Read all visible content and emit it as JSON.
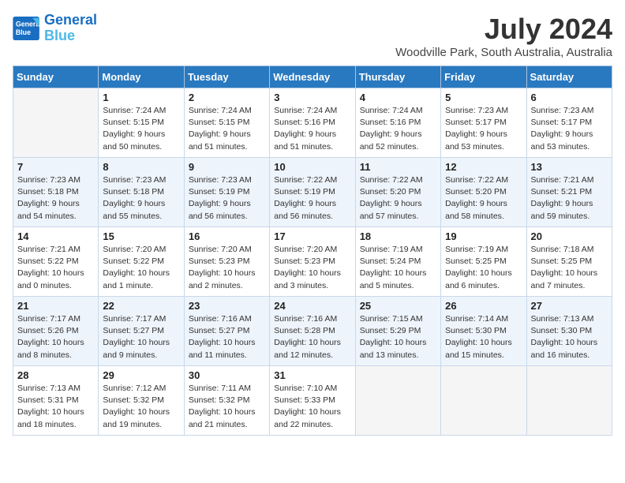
{
  "header": {
    "logo_line1": "General",
    "logo_line2": "Blue",
    "month": "July 2024",
    "location": "Woodville Park, South Australia, Australia"
  },
  "weekdays": [
    "Sunday",
    "Monday",
    "Tuesday",
    "Wednesday",
    "Thursday",
    "Friday",
    "Saturday"
  ],
  "weeks": [
    [
      {
        "day": "",
        "info": ""
      },
      {
        "day": "1",
        "info": "Sunrise: 7:24 AM\nSunset: 5:15 PM\nDaylight: 9 hours\nand 50 minutes."
      },
      {
        "day": "2",
        "info": "Sunrise: 7:24 AM\nSunset: 5:15 PM\nDaylight: 9 hours\nand 51 minutes."
      },
      {
        "day": "3",
        "info": "Sunrise: 7:24 AM\nSunset: 5:16 PM\nDaylight: 9 hours\nand 51 minutes."
      },
      {
        "day": "4",
        "info": "Sunrise: 7:24 AM\nSunset: 5:16 PM\nDaylight: 9 hours\nand 52 minutes."
      },
      {
        "day": "5",
        "info": "Sunrise: 7:23 AM\nSunset: 5:17 PM\nDaylight: 9 hours\nand 53 minutes."
      },
      {
        "day": "6",
        "info": "Sunrise: 7:23 AM\nSunset: 5:17 PM\nDaylight: 9 hours\nand 53 minutes."
      }
    ],
    [
      {
        "day": "7",
        "info": "Sunrise: 7:23 AM\nSunset: 5:18 PM\nDaylight: 9 hours\nand 54 minutes."
      },
      {
        "day": "8",
        "info": "Sunrise: 7:23 AM\nSunset: 5:18 PM\nDaylight: 9 hours\nand 55 minutes."
      },
      {
        "day": "9",
        "info": "Sunrise: 7:23 AM\nSunset: 5:19 PM\nDaylight: 9 hours\nand 56 minutes."
      },
      {
        "day": "10",
        "info": "Sunrise: 7:22 AM\nSunset: 5:19 PM\nDaylight: 9 hours\nand 56 minutes."
      },
      {
        "day": "11",
        "info": "Sunrise: 7:22 AM\nSunset: 5:20 PM\nDaylight: 9 hours\nand 57 minutes."
      },
      {
        "day": "12",
        "info": "Sunrise: 7:22 AM\nSunset: 5:20 PM\nDaylight: 9 hours\nand 58 minutes."
      },
      {
        "day": "13",
        "info": "Sunrise: 7:21 AM\nSunset: 5:21 PM\nDaylight: 9 hours\nand 59 minutes."
      }
    ],
    [
      {
        "day": "14",
        "info": "Sunrise: 7:21 AM\nSunset: 5:22 PM\nDaylight: 10 hours\nand 0 minutes."
      },
      {
        "day": "15",
        "info": "Sunrise: 7:20 AM\nSunset: 5:22 PM\nDaylight: 10 hours\nand 1 minute."
      },
      {
        "day": "16",
        "info": "Sunrise: 7:20 AM\nSunset: 5:23 PM\nDaylight: 10 hours\nand 2 minutes."
      },
      {
        "day": "17",
        "info": "Sunrise: 7:20 AM\nSunset: 5:23 PM\nDaylight: 10 hours\nand 3 minutes."
      },
      {
        "day": "18",
        "info": "Sunrise: 7:19 AM\nSunset: 5:24 PM\nDaylight: 10 hours\nand 5 minutes."
      },
      {
        "day": "19",
        "info": "Sunrise: 7:19 AM\nSunset: 5:25 PM\nDaylight: 10 hours\nand 6 minutes."
      },
      {
        "day": "20",
        "info": "Sunrise: 7:18 AM\nSunset: 5:25 PM\nDaylight: 10 hours\nand 7 minutes."
      }
    ],
    [
      {
        "day": "21",
        "info": "Sunrise: 7:17 AM\nSunset: 5:26 PM\nDaylight: 10 hours\nand 8 minutes."
      },
      {
        "day": "22",
        "info": "Sunrise: 7:17 AM\nSunset: 5:27 PM\nDaylight: 10 hours\nand 9 minutes."
      },
      {
        "day": "23",
        "info": "Sunrise: 7:16 AM\nSunset: 5:27 PM\nDaylight: 10 hours\nand 11 minutes."
      },
      {
        "day": "24",
        "info": "Sunrise: 7:16 AM\nSunset: 5:28 PM\nDaylight: 10 hours\nand 12 minutes."
      },
      {
        "day": "25",
        "info": "Sunrise: 7:15 AM\nSunset: 5:29 PM\nDaylight: 10 hours\nand 13 minutes."
      },
      {
        "day": "26",
        "info": "Sunrise: 7:14 AM\nSunset: 5:30 PM\nDaylight: 10 hours\nand 15 minutes."
      },
      {
        "day": "27",
        "info": "Sunrise: 7:13 AM\nSunset: 5:30 PM\nDaylight: 10 hours\nand 16 minutes."
      }
    ],
    [
      {
        "day": "28",
        "info": "Sunrise: 7:13 AM\nSunset: 5:31 PM\nDaylight: 10 hours\nand 18 minutes."
      },
      {
        "day": "29",
        "info": "Sunrise: 7:12 AM\nSunset: 5:32 PM\nDaylight: 10 hours\nand 19 minutes."
      },
      {
        "day": "30",
        "info": "Sunrise: 7:11 AM\nSunset: 5:32 PM\nDaylight: 10 hours\nand 21 minutes."
      },
      {
        "day": "31",
        "info": "Sunrise: 7:10 AM\nSunset: 5:33 PM\nDaylight: 10 hours\nand 22 minutes."
      },
      {
        "day": "",
        "info": ""
      },
      {
        "day": "",
        "info": ""
      },
      {
        "day": "",
        "info": ""
      }
    ]
  ]
}
